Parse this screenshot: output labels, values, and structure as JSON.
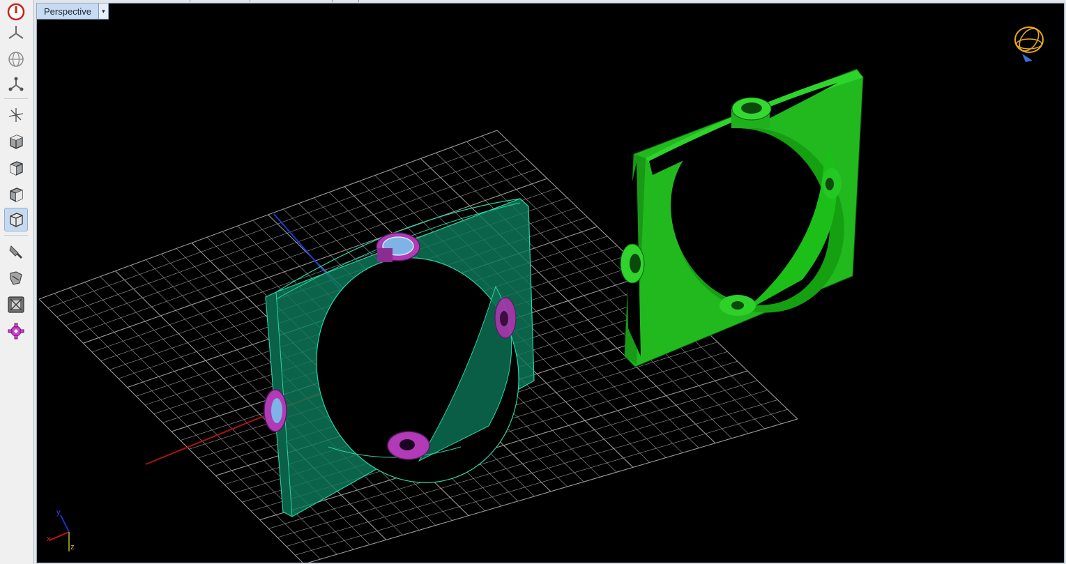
{
  "viewport": {
    "name": "Perspective",
    "dropdown_glyph": "▾",
    "background": "#000000"
  },
  "toolbar": {
    "buttons": [
      {
        "name": "power-icon",
        "active": false
      },
      {
        "name": "perspective-view-icon",
        "active": false
      },
      {
        "name": "globe-icon",
        "active": false
      },
      {
        "name": "snap-nodes-icon",
        "active": false
      },
      {
        "name": "axes-gizmo-icon",
        "active": false
      },
      {
        "name": "top-view-cube-icon",
        "active": false
      },
      {
        "name": "front-view-cube-icon",
        "active": false
      },
      {
        "name": "right-view-cube-icon",
        "active": false
      },
      {
        "name": "iso-view-cube-icon",
        "active": true
      },
      {
        "name": "render-tool-icon",
        "active": false
      },
      {
        "name": "pan-tool-icon",
        "active": false
      },
      {
        "name": "zoom-extents-icon",
        "active": false
      },
      {
        "name": "settings-gear-icon",
        "active": false
      }
    ]
  },
  "axis_triad": {
    "x": "x",
    "y": "y",
    "z": "z"
  },
  "colors": {
    "grid": "#9a9a9a",
    "ring_selected": "#0e8a66",
    "ring_unselected": "#1ec81e",
    "settings": "#cf3fd3",
    "x_axis": "#cc1111",
    "y_axis": "#1133cc",
    "nav_orb": "#e8a81c"
  }
}
